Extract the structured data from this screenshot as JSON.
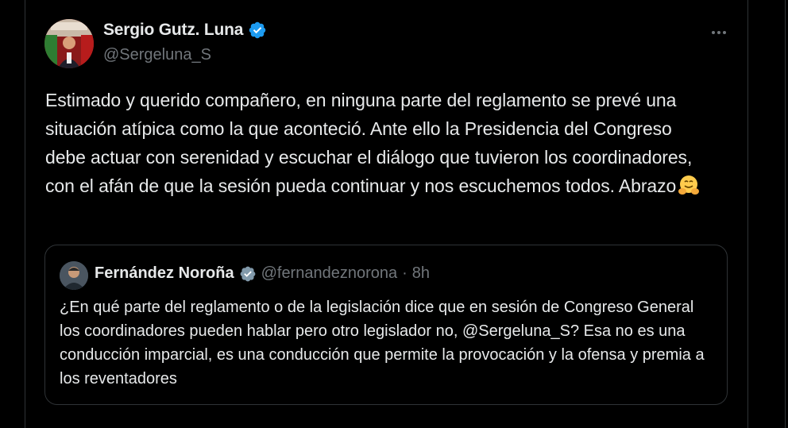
{
  "colors": {
    "background": "#000000",
    "text_primary": "#e7e9ea",
    "text_secondary": "#71767b",
    "border": "#2f3336",
    "verified_blue": "#1d9bf0",
    "verified_gray": "#829aab"
  },
  "tweet": {
    "author": {
      "display_name": "Sergio Gutz. Luna",
      "handle": "@Sergeluna_S",
      "verified_icon": "verified-badge-icon",
      "avatar_icon": "user-avatar"
    },
    "more_icon": "more-options-icon",
    "text": "Estimado y querido compañero, en ninguna parte del reglamento se prevé una situación atípica como la que aconteció. Ante ello la Presidencia del Congreso debe actuar con serenidad y escuchar el diálogo que tuvieron los coordinadores, con el afán de que la sesión pueda continuar y nos escuchemos todos. Abrazo",
    "emoji_icon": "hugging-face-emoji",
    "quoted": {
      "display_name": "Fernández Noroña",
      "handle": "@fernandeznorona",
      "separator": "·",
      "time": "8h",
      "verified_icon": "verified-gray-badge-icon",
      "text": "¿En qué parte del reglamento o de la legislación dice que en sesión de Congreso General los coordinadores pueden hablar pero otro legislador no, @Sergeluna_S? Esa no es una conducción imparcial, es una conducción que permite la provocación y la ofensa y premia a los reventadores"
    }
  }
}
